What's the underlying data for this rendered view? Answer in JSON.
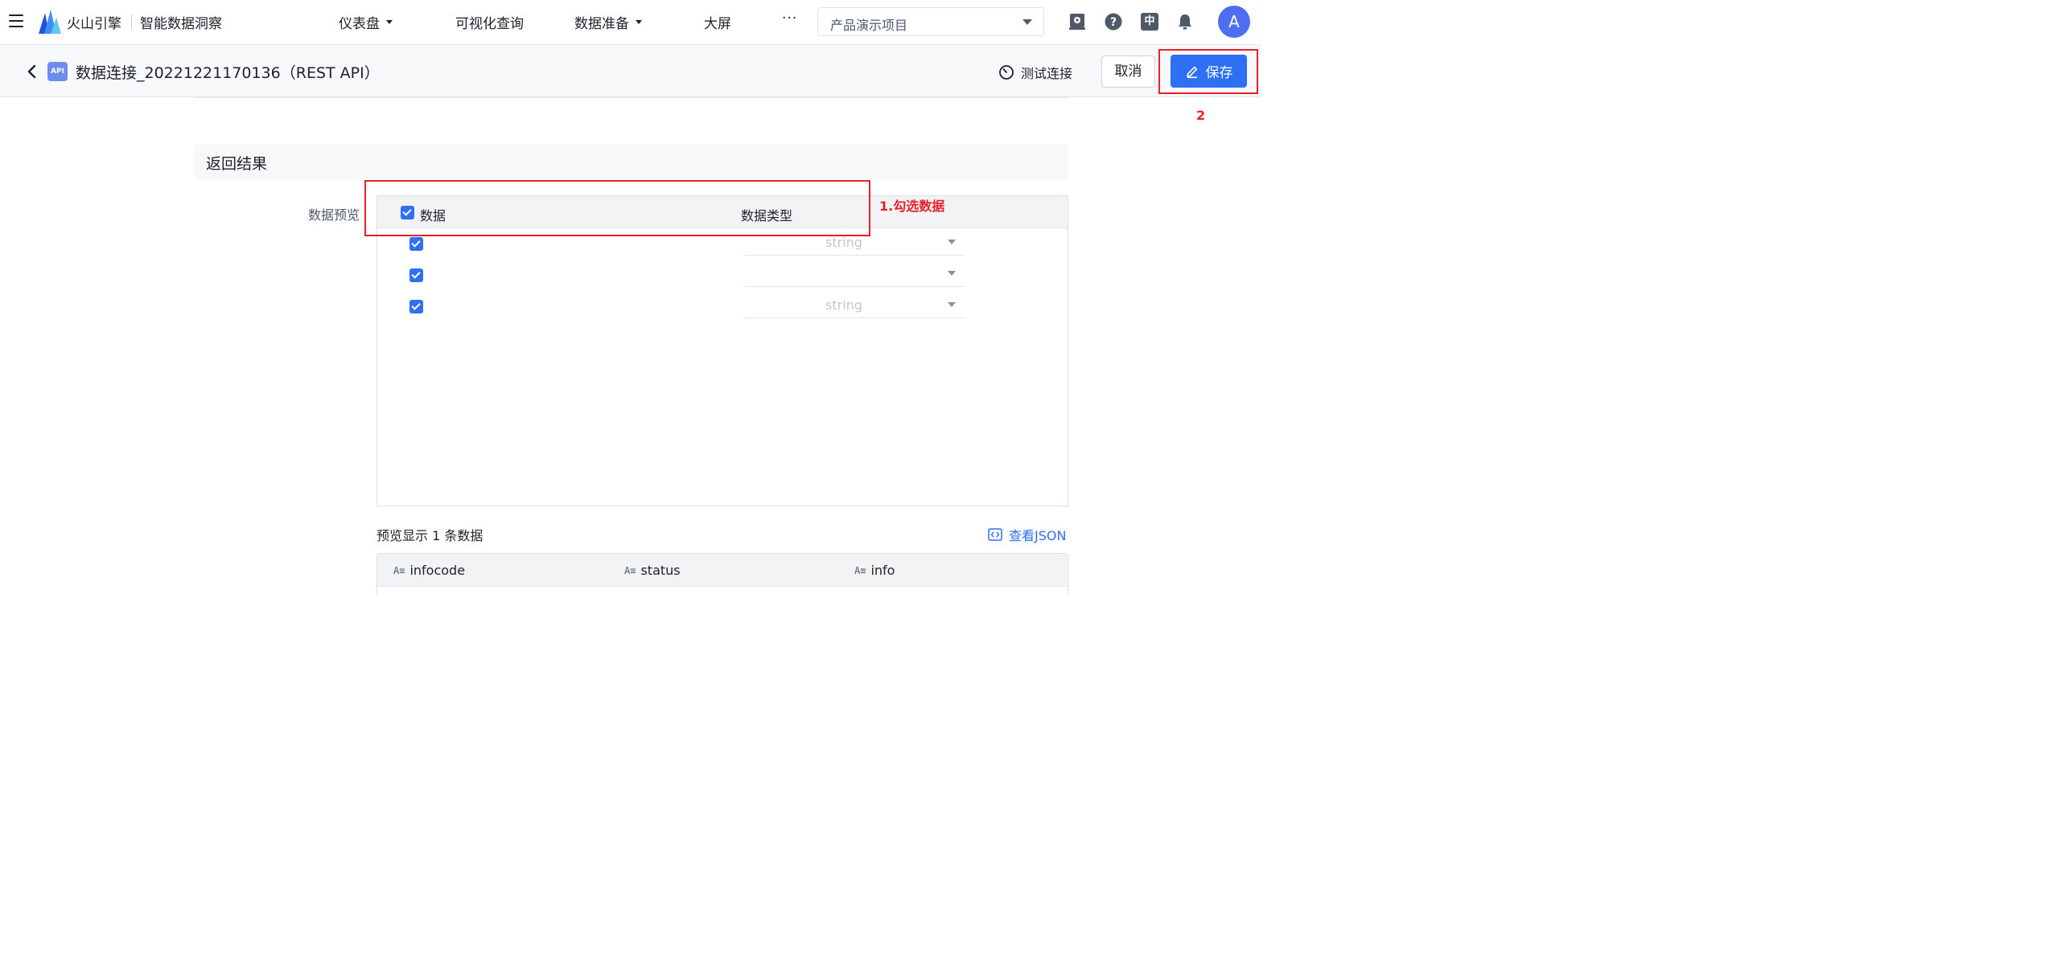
{
  "topnav": {
    "brand": "火山引擎",
    "product": "智能数据洞察",
    "items": [
      {
        "label": "仪表盘",
        "has_caret": true
      },
      {
        "label": "可视化查询",
        "has_caret": false
      },
      {
        "label": "数据准备",
        "has_caret": true
      },
      {
        "label": "大屏",
        "has_caret": false
      }
    ],
    "more": "···",
    "project": "产品演示项目",
    "lang_badge": "中",
    "avatar": "A"
  },
  "subheader": {
    "api_badge": "API",
    "title": "数据连接_20221221170136（REST API）",
    "test_conn": "测试连接",
    "cancel": "取消",
    "save": "保存"
  },
  "annotations": {
    "step1": "1.勾选数据",
    "step2": "2"
  },
  "result": {
    "section_title": "返回结果",
    "preview_label": "数据预览",
    "columns": {
      "data": "数据",
      "type": "数据类型"
    },
    "rows": [
      {
        "checked": true,
        "type": "string"
      },
      {
        "checked": true,
        "type": ""
      },
      {
        "checked": true,
        "type": "string"
      }
    ],
    "preview_count": "预览显示 1 条数据",
    "view_json": "查看JSON",
    "result_columns": [
      {
        "name": "infocode",
        "icon": "text-type-icon"
      },
      {
        "name": "status",
        "icon": "text-type-icon"
      },
      {
        "name": "info",
        "icon": "text-type-icon"
      }
    ],
    "type_icon_text": "A≡"
  },
  "colors": {
    "primary": "#2f6ff4",
    "annotation_red": "#e8202a",
    "avatar": "#4e6ef2"
  }
}
